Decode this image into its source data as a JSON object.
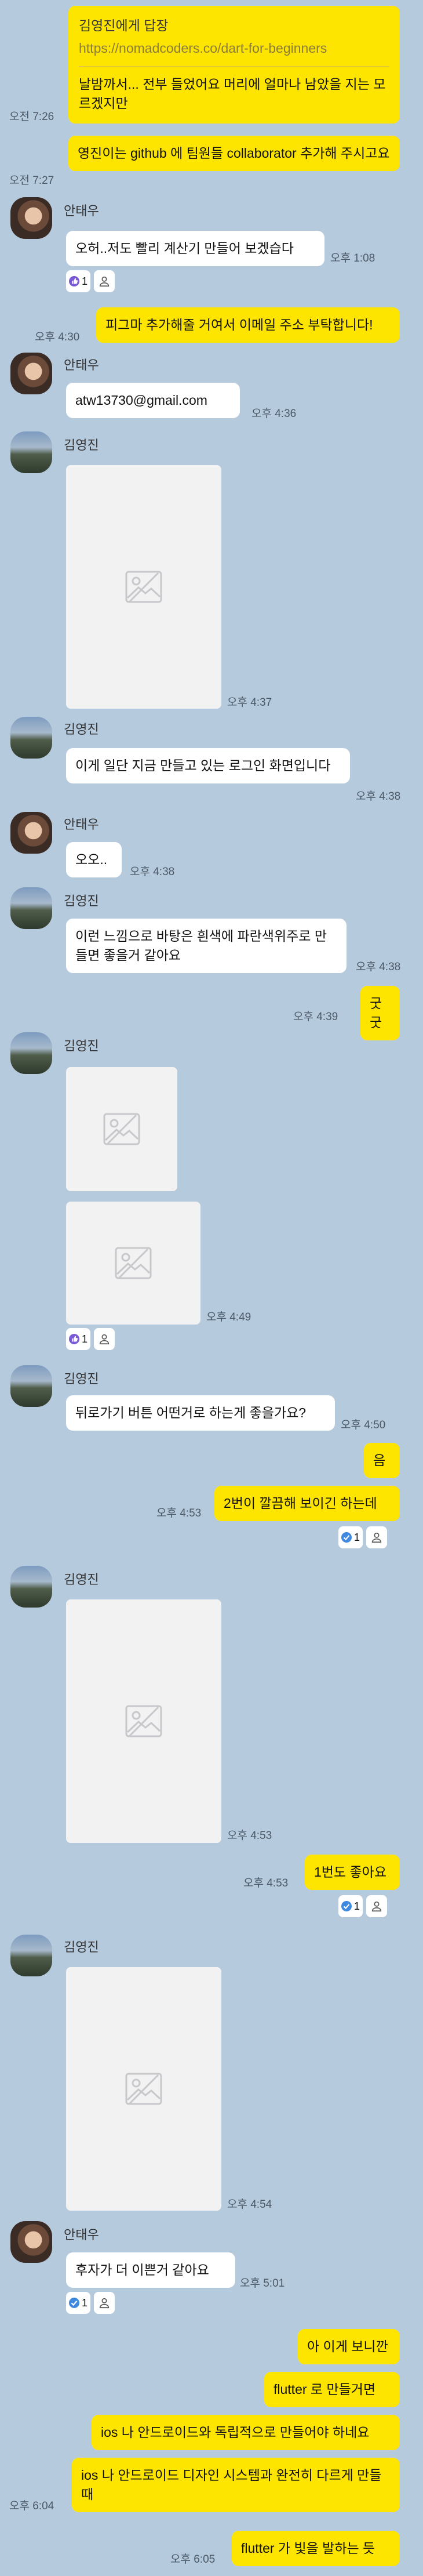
{
  "colors": {
    "background": "#b6cadd",
    "my_bubble": "#fee500",
    "other_bubble": "#ffffff",
    "reaction_like": "#7b5cd6",
    "reaction_check": "#3f8ae0"
  },
  "messages": {
    "m1": {
      "reply_to": "김영진에게 답장",
      "quoted": "https://nomadcoders.co/dart-for-beginners",
      "text": "날밤까서... 전부 들었어요 머리에 얼마나 남았을 지는 모르겠지만",
      "time": "오전 7:26"
    },
    "m2": {
      "text": "영진이는 github 에 팀원들 collaborator 추가해 주시고요",
      "time": "오전 7:27"
    },
    "m3": {
      "sender": "안태우",
      "text": "오허..저도 빨리 계산기 만들어 보겠습다",
      "time": "오후 1:08",
      "reaction_count": "1"
    },
    "m4": {
      "text": "피그마 추가해줄 거여서 이메일 주소 부탁합니다!",
      "time": "오후 4:30"
    },
    "m5": {
      "sender": "안태우",
      "text": "atw13730@gmail.com",
      "time": "오후 4:36"
    },
    "m6": {
      "sender": "김영진",
      "time": "오후 4:37"
    },
    "m7": {
      "sender": "김영진",
      "text": "이게 일단 지금 만들고 있는 로그인 화면입니다",
      "time": "오후 4:38"
    },
    "m8": {
      "sender": "안태우",
      "text": "오오..",
      "time": "오후 4:38"
    },
    "m9": {
      "sender": "김영진",
      "text": "이런 느낌으로 바탕은 흰색에 파란색위주로 만들면 좋을거 같아요",
      "time": "오후 4:38"
    },
    "m10": {
      "text": "굿굿",
      "time": "오후 4:39"
    },
    "m11": {
      "sender": "김영진",
      "time": "오후 4:49",
      "reaction_count": "1"
    },
    "m12": {
      "sender": "김영진",
      "text": "뒤로가기 버튼 어떤거로 하는게 좋을가요?",
      "time": "오후 4:50"
    },
    "m13": {
      "text": "음"
    },
    "m14": {
      "text": "2번이 깔끔해 보이긴 하는데",
      "time": "오후 4:53",
      "reaction_count": "1"
    },
    "m15": {
      "sender": "김영진",
      "time": "오후 4:53"
    },
    "m16": {
      "text": "1번도 좋아요",
      "time": "오후 4:53",
      "reaction_count": "1"
    },
    "m17": {
      "sender": "김영진",
      "time": "오후 4:54"
    },
    "m18": {
      "sender": "안태우",
      "text": "후자가 더 이쁜거 같아요",
      "time": "오후 5:01",
      "reaction_count": "1"
    },
    "m19": {
      "text": "아 이게 보니깐"
    },
    "m20": {
      "text": "flutter 로 만들거면"
    },
    "m21": {
      "text": "ios 나 안드로이드와 독립적으로 만들어야 하네요"
    },
    "m22": {
      "text": "ios 나 안드로이드 디자인 시스템과 완전히 다르게 만들 때",
      "time": "오후 6:04"
    },
    "m23": {
      "text": "flutter 가 빛을 발하는 듯",
      "time": "오후 6:05"
    }
  }
}
